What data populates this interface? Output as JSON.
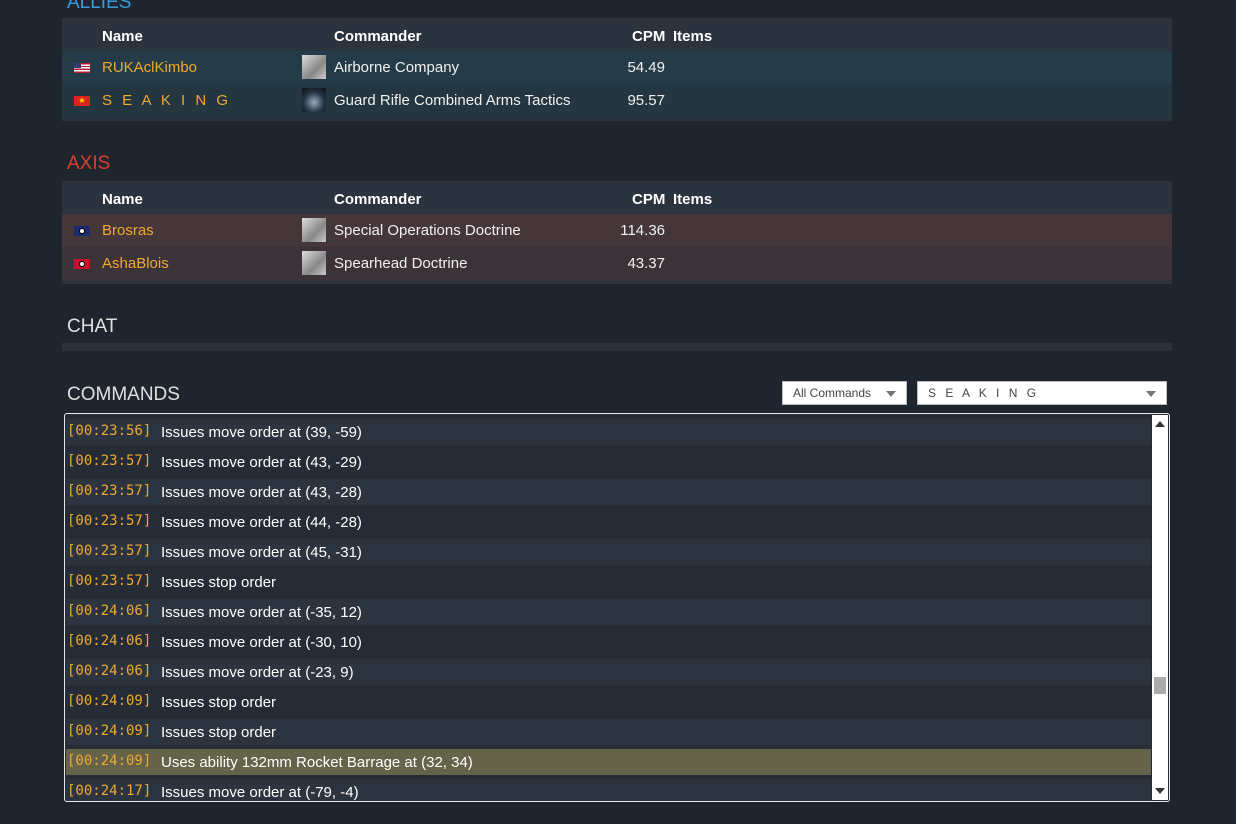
{
  "allies": {
    "title": "ALLIES",
    "headers": {
      "name": "Name",
      "commander": "Commander",
      "cpm": "CPM",
      "items": "Items"
    },
    "players": [
      {
        "name": "RUKAclKimbo",
        "flag": "us-flag-icon",
        "commander": "Airborne Company",
        "cpm": "54.49"
      },
      {
        "name": "S E A K I N G",
        "flag": "vietnam-flag-icon",
        "commander": "Guard Rifle Combined Arms Tactics",
        "cpm": "95.57"
      }
    ]
  },
  "axis": {
    "title": "AXIS",
    "headers": {
      "name": "Name",
      "commander": "Commander",
      "cpm": "CPM",
      "items": "Items"
    },
    "players": [
      {
        "name": "Brosras",
        "flag": "axis-flag-icon",
        "commander": "Special Operations Doctrine",
        "cpm": "114.36"
      },
      {
        "name": "AshaBlois",
        "flag": "axis-flag-icon",
        "commander": "Spearhead Doctrine",
        "cpm": "43.37"
      }
    ]
  },
  "chat": {
    "title": "CHAT"
  },
  "commands": {
    "title": "COMMANDS",
    "filter_value": "All Commands",
    "player_value": "S E A K I N G",
    "highlight_color": "#65634a",
    "timestamp_color": "#f0a830",
    "log": [
      {
        "ts": "[00:23:56]",
        "msg": "Issues move order at (39, -59)"
      },
      {
        "ts": "[00:23:57]",
        "msg": "Issues move order at (43, -29)"
      },
      {
        "ts": "[00:23:57]",
        "msg": "Issues move order at (43, -28)"
      },
      {
        "ts": "[00:23:57]",
        "msg": "Issues move order at (44, -28)"
      },
      {
        "ts": "[00:23:57]",
        "msg": "Issues move order at (45, -31)"
      },
      {
        "ts": "[00:23:57]",
        "msg": "Issues stop order"
      },
      {
        "ts": "[00:24:06]",
        "msg": "Issues move order at (-35, 12)"
      },
      {
        "ts": "[00:24:06]",
        "msg": "Issues move order at (-30, 10)"
      },
      {
        "ts": "[00:24:06]",
        "msg": "Issues move order at (-23, 9)"
      },
      {
        "ts": "[00:24:09]",
        "msg": "Issues stop order"
      },
      {
        "ts": "[00:24:09]",
        "msg": "Issues stop order"
      },
      {
        "ts": "[00:24:09]",
        "msg": "Uses ability 132mm Rocket Barrage at (32, 34)",
        "highlight": true
      },
      {
        "ts": "[00:24:17]",
        "msg": "Issues move order at (-79, -4)"
      }
    ]
  }
}
